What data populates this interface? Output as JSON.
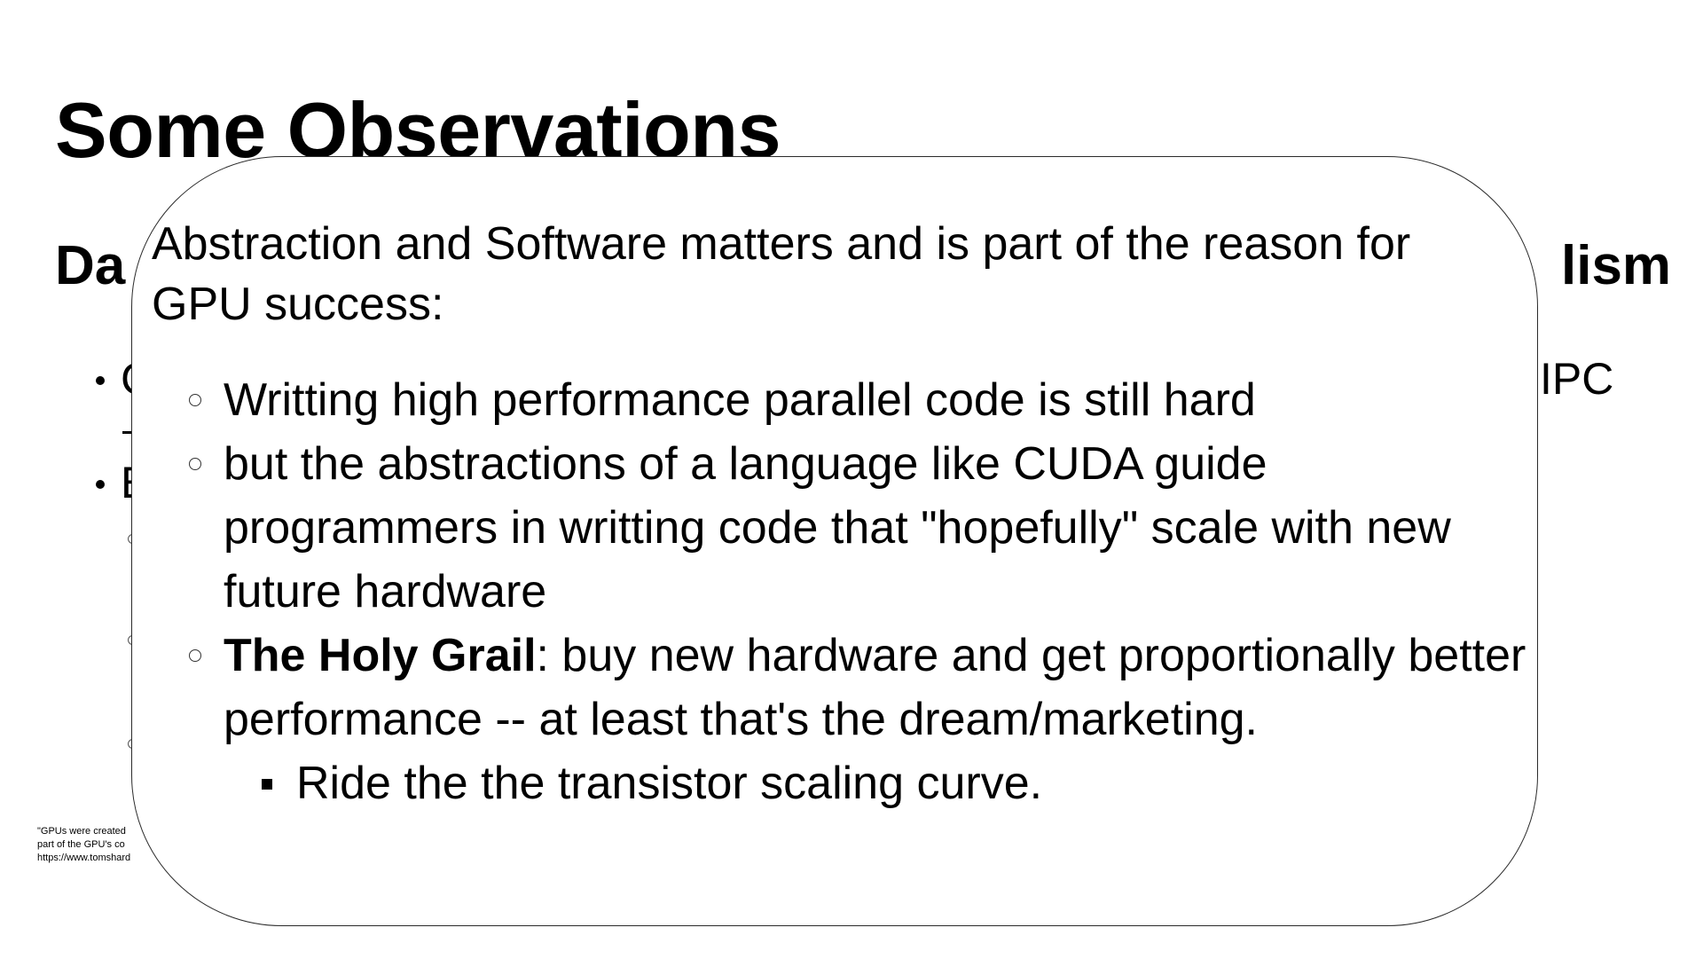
{
  "slide": {
    "title": "Some Observations",
    "background_heading_left": "Da",
    "background_heading_right": "lism",
    "background_bullet_1_fragment": "C",
    "background_bullet_1_right": "IPC",
    "background_bullet_2_fragment": "E",
    "footnote": {
      "line1": "\"GPUs were created",
      "line2": "part of the GPU's co",
      "line3": "https://www.tomshard"
    }
  },
  "overlay": {
    "heading": "Abstraction and Software matters and is part of the reason for GPU success:",
    "items": [
      {
        "text": "Writting high performance parallel code is still hard"
      },
      {
        "text": "but the abstractions of a language like CUDA guide programmers in writting code that \"hopefully\" scale with new future hardware"
      },
      {
        "bold": "The Holy Grail",
        "text": ": buy new hardware and get proportionally better performance  -- at least that's the dream/marketing."
      }
    ],
    "subitems": [
      {
        "text": "Ride the the transistor scaling curve."
      }
    ]
  }
}
